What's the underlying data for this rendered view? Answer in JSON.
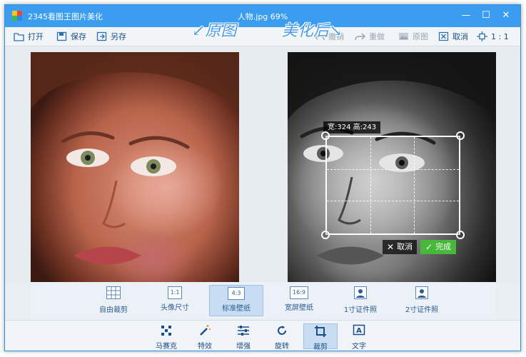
{
  "window": {
    "app_title": "2345看图王图片美化",
    "doc_title": "人物.jpg  69%",
    "controls": {
      "minimize": "—",
      "maximize": "☐",
      "close": "✕"
    }
  },
  "toolbar": {
    "open": "打开",
    "save": "保存",
    "save_as": "另存",
    "undo": "撤销",
    "redo": "重做",
    "original": "原图",
    "cancel": "取消",
    "actual_size": "1 : 1"
  },
  "canvas": {
    "label_before": "↙原图",
    "label_after": "美化后↘",
    "crop": {
      "size_text": "宽:324  高:243",
      "cancel": "取消",
      "done": "完成"
    }
  },
  "crop_presets": [
    {
      "label": "自由裁剪",
      "icon": "grid-icon"
    },
    {
      "label": "头像尺寸",
      "icon": "1:1"
    },
    {
      "label": "标准壁纸",
      "icon": "4:3",
      "active": true
    },
    {
      "label": "宽屏壁纸",
      "icon": "16:9"
    },
    {
      "label": "1寸证件照",
      "icon": "portrait-icon"
    },
    {
      "label": "2寸证件照",
      "icon": "portrait-icon"
    }
  ],
  "bottom_tools": [
    {
      "label": "马赛克",
      "icon": "mosaic-icon"
    },
    {
      "label": "特效",
      "icon": "magic-wand-icon"
    },
    {
      "label": "增强",
      "icon": "sliders-icon"
    },
    {
      "label": "旋转",
      "icon": "rotate-icon"
    },
    {
      "label": "裁剪",
      "icon": "crop-icon",
      "active": true
    },
    {
      "label": "文字",
      "icon": "text-icon"
    }
  ],
  "colors": {
    "titlebar": "#3b9df0",
    "accent": "#1c4f86",
    "done_green": "#47b83a",
    "active_tool_bg": "#c8dcf3"
  }
}
